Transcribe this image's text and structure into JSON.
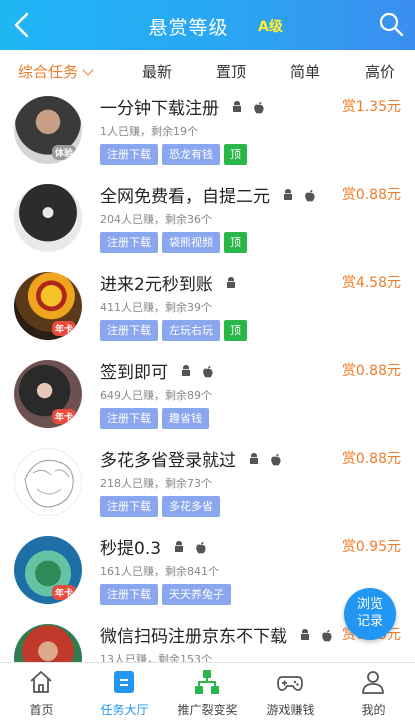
{
  "header": {
    "title": "悬赏等级",
    "level": "A级"
  },
  "tabs": [
    {
      "label": "综合任务"
    },
    {
      "label": "最新"
    },
    {
      "label": "置顶"
    },
    {
      "label": "简单"
    },
    {
      "label": "高价"
    }
  ],
  "tasks": [
    {
      "title": "一分钟下载注册",
      "meta": "1人已赚，剩余19个",
      "reward": "赏1.35元",
      "tags": [
        "注册下载",
        "恐龙有钱"
      ],
      "top": "顶",
      "badge": "体验",
      "platforms": [
        "android",
        "apple"
      ]
    },
    {
      "title": "全网免费看，自提二元",
      "meta": "204人已赚，剩余36个",
      "reward": "赏0.88元",
      "tags": [
        "注册下载",
        "袋熊视频"
      ],
      "top": "顶",
      "badge": "",
      "platforms": [
        "android",
        "apple"
      ]
    },
    {
      "title": "进来2元秒到账",
      "meta": "411人已赚，剩余39个",
      "reward": "赏4.58元",
      "tags": [
        "注册下载",
        "左玩右玩"
      ],
      "top": "顶",
      "badge": "年卡",
      "platforms": [
        "android"
      ]
    },
    {
      "title": "签到即可",
      "meta": "649人已赚，剩余89个",
      "reward": "赏0.88元",
      "tags": [
        "注册下载",
        "趣省钱"
      ],
      "top": "",
      "badge": "年卡",
      "platforms": [
        "android",
        "apple"
      ]
    },
    {
      "title": "多花多省登录就过",
      "meta": "218人已赚，剩余73个",
      "reward": "赏0.88元",
      "tags": [
        "注册下载",
        "多花多省"
      ],
      "top": "",
      "badge": "",
      "platforms": [
        "android",
        "apple"
      ]
    },
    {
      "title": "秒提0.3",
      "meta": "161人已赚，剩余841个",
      "reward": "赏0.95元",
      "tags": [
        "注册下载",
        "天天养兔子"
      ],
      "top": "",
      "badge": "年卡",
      "platforms": [
        "android",
        "apple"
      ]
    },
    {
      "title": "微信扫码注册京东不下载",
      "meta": "13人已赚，剩余153个",
      "reward": "赏0.75元",
      "tags": [],
      "top": "",
      "badge": "",
      "platforms": [
        "android",
        "apple"
      ]
    }
  ],
  "float_button": {
    "line1": "浏览",
    "line2": "记录"
  },
  "bottom_nav": [
    {
      "label": "首页",
      "icon": "home-icon"
    },
    {
      "label": "任务大厅",
      "icon": "task-hall-icon"
    },
    {
      "label": "推广裂变奖",
      "icon": "share-network-icon"
    },
    {
      "label": "游戏赚钱",
      "icon": "gamepad-icon"
    },
    {
      "label": "我的",
      "icon": "user-icon"
    }
  ],
  "colors": {
    "header_start": "#1fb6f4",
    "header_end": "#3b8ef0",
    "accent_orange": "#f07b2a",
    "tag_blue": "#8aa6ef",
    "tag_green": "#2ab74a",
    "active_blue": "#2196f3"
  }
}
